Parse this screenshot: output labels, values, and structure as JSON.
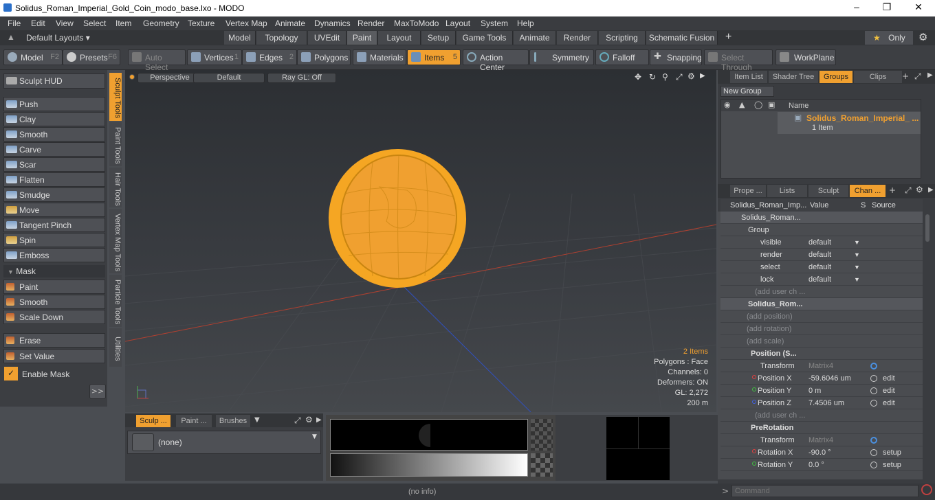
{
  "window": {
    "title": "Solidus_Roman_Imperial_Gold_Coin_modo_base.lxo - MODO"
  },
  "menu": [
    "File",
    "Edit",
    "View",
    "Select",
    "Item",
    "Geometry",
    "Texture",
    "Vertex Map",
    "Animate",
    "Dynamics",
    "Render",
    "MaxToModo",
    "Layout",
    "System",
    "Help"
  ],
  "layoutbar": {
    "default_layouts": "Default Layouts",
    "tabs": [
      "Model",
      "Topology",
      "UVEdit",
      "Paint",
      "Layout",
      "Setup",
      "Game Tools",
      "Animate",
      "Render",
      "Scripting",
      "Schematic Fusion"
    ],
    "active_tab": "Paint",
    "plus": "+",
    "only_label": "Only"
  },
  "toolbar": {
    "model": "Model",
    "model_key": "F2",
    "presets": "Presets",
    "presets_key": "F6",
    "auto_select": "Auto Select",
    "vertices": "Vertices",
    "vertices_num": "1",
    "edges": "Edges",
    "edges_num": "2",
    "polygons": "Polygons",
    "materials": "Materials",
    "items": "Items",
    "items_num": "5",
    "action_center": "Action Center",
    "symmetry": "Symmetry",
    "falloff": "Falloff",
    "snapping": "Snapping",
    "select_through": "Select Through",
    "workplane": "WorkPlane"
  },
  "left": {
    "sculpt_hud": "Sculpt HUD",
    "tools": [
      "Push",
      "Clay",
      "Smooth",
      "Carve",
      "Scar",
      "Flatten",
      "Smudge",
      "Move",
      "Tangent Pinch",
      "Spin",
      "Emboss"
    ],
    "mask_header": "Mask",
    "mask_tools": [
      "Paint",
      "Smooth",
      "Scale Down"
    ],
    "erase": "Erase",
    "set_value": "Set Value",
    "enable_mask": "Enable Mask",
    "more": ">>",
    "vtabs": [
      "Sculpt Tools",
      "Paint Tools",
      "Hair Tools",
      "Vertex Map Tools",
      "Particle Tools",
      "Utilities"
    ]
  },
  "viewport": {
    "view": "Perspective",
    "shading": "Default",
    "raygl": "Ray GL: Off",
    "info": {
      "items": "2 Items",
      "polygons": "Polygons : Face",
      "channels": "Channels: 0",
      "deformers": "Deformers: ON",
      "gl": "GL: 2,272",
      "distance": "200 m"
    }
  },
  "groups_panel": {
    "tabs": [
      "Item List",
      "Shader Tree",
      "Groups",
      "Clips"
    ],
    "active": "Groups",
    "new_group": "New Group",
    "col_name": "Name",
    "group_name": "Solidus_Roman_Imperial_ ...",
    "group_count": "1 Item"
  },
  "channels_panel": {
    "tabs": [
      "Prope ...",
      "Lists",
      "Sculpt",
      "Chan ..."
    ],
    "active": "Chan ...",
    "headers": [
      "Solidus_Roman_Imp...",
      "Value",
      "S",
      "Source"
    ],
    "rows": [
      {
        "name": "Solidus_Roman...",
        "value": "",
        "src": ""
      },
      {
        "name": "Group",
        "value": "",
        "src": ""
      },
      {
        "name": "visible",
        "value": "default",
        "src": ""
      },
      {
        "name": "render",
        "value": "default",
        "src": ""
      },
      {
        "name": "select",
        "value": "default",
        "src": ""
      },
      {
        "name": "lock",
        "value": "default",
        "src": ""
      },
      {
        "name": "(add user ch ...",
        "value": "",
        "src": ""
      },
      {
        "name": "Solidus_Rom...",
        "value": "",
        "src": ""
      },
      {
        "name": "(add position)",
        "value": "",
        "src": ""
      },
      {
        "name": "(add rotation)",
        "value": "",
        "src": ""
      },
      {
        "name": "(add scale)",
        "value": "",
        "src": ""
      },
      {
        "name": "Position (S...",
        "value": "",
        "src": ""
      },
      {
        "name": "Transform",
        "value": "Matrix4",
        "src": ""
      },
      {
        "name": "Position X",
        "value": "-59.6046 um",
        "src": "edit"
      },
      {
        "name": "Position Y",
        "value": "0 m",
        "src": "edit"
      },
      {
        "name": "Position Z",
        "value": "7.4506 um",
        "src": "edit"
      },
      {
        "name": "(add user ch ...",
        "value": "",
        "src": ""
      },
      {
        "name": "PreRotation",
        "value": "",
        "src": ""
      },
      {
        "name": "Transform",
        "value": "Matrix4",
        "src": ""
      },
      {
        "name": "Rotation X",
        "value": "-90.0 °",
        "src": "setup"
      },
      {
        "name": "Rotation Y",
        "value": "0.0 °",
        "src": "setup"
      }
    ]
  },
  "bottom": {
    "tabs": [
      "Sculp ...",
      "Paint ...",
      "Brushes"
    ],
    "brush": "(none)"
  },
  "status": {
    "info": "(no info)",
    "command_placeholder": "Command"
  },
  "colors": {
    "accent": "#f0a030",
    "coin": "#f5a623"
  }
}
